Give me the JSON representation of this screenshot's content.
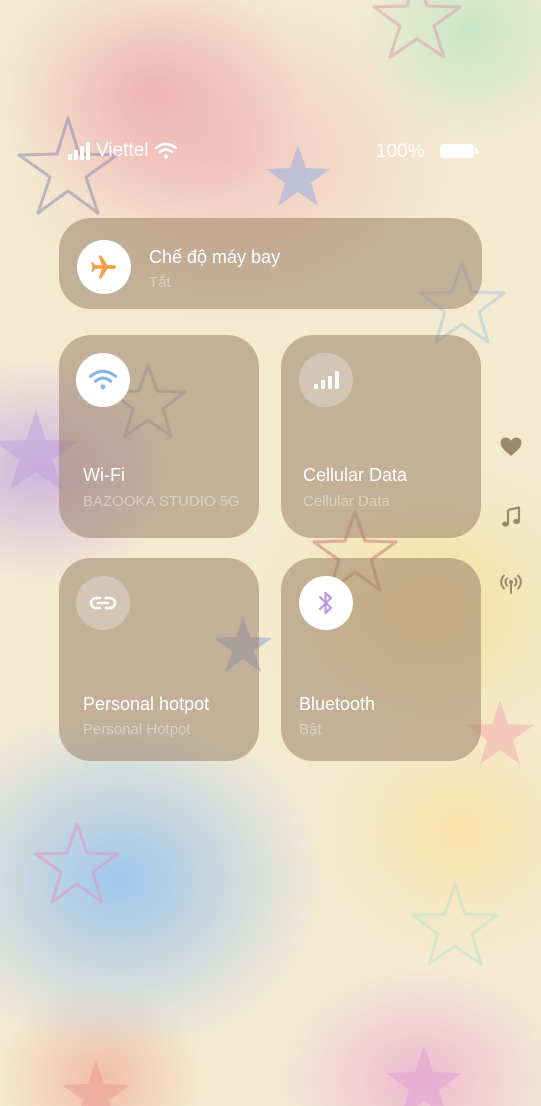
{
  "status_bar": {
    "carrier": "Viettel",
    "battery_percent": "100%"
  },
  "airplane_mode": {
    "title": "Chế độ máy bay",
    "status": "Tắt",
    "icon": "airplane-icon"
  },
  "tiles": {
    "wifi": {
      "title": "Wi-Fi",
      "subtitle": "BAZOOKA STUDIO 5G",
      "icon": "wifi-icon"
    },
    "cellular": {
      "title": "Cellular Data",
      "subtitle": "Cellular Data",
      "icon": "signal-bars-icon"
    },
    "hotspot": {
      "title": "Personal hotpot",
      "subtitle": "Personal Hotpot",
      "icon": "link-icon"
    },
    "bluetooth": {
      "title": "Bluetooth",
      "subtitle": "Bật",
      "icon": "bluetooth-icon"
    }
  },
  "side_icons": [
    "heart-icon",
    "music-note-icon",
    "broadcast-icon"
  ],
  "colors": {
    "airplane_icon": "#f2a04a",
    "wifi_icon": "#86b6ec",
    "bluetooth_icon": "#b79ae8",
    "card_background": "#a0876e"
  }
}
